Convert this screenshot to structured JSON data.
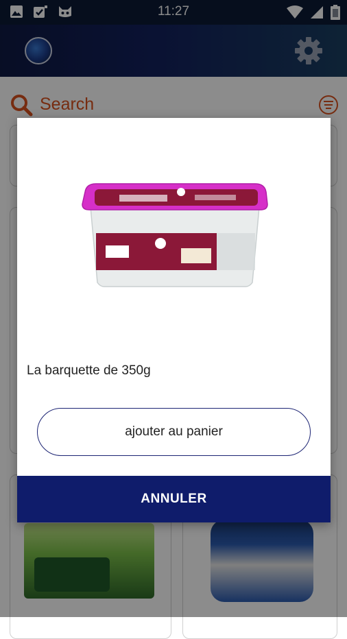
{
  "status_bar": {
    "time": "11:27",
    "left_icons": [
      "image-icon",
      "clipboard-check-icon",
      "cat-face-icon"
    ],
    "right_icons": [
      "wifi-icon",
      "signal-icon",
      "battery-icon"
    ]
  },
  "app_bar": {
    "logo_icon": "globe-logo-icon",
    "settings_icon": "gear-icon"
  },
  "search": {
    "placeholder": "Search",
    "accent_color": "#d9501e"
  },
  "dialog": {
    "product_description": "La barquette de 350g",
    "add_button_label": "ajouter au panier",
    "cancel_button_label": "ANNULER"
  },
  "colors": {
    "app_bar_start": "#0f1a44",
    "app_bar_end": "#1a3f62",
    "cancel_button": "#0f1c6b"
  }
}
